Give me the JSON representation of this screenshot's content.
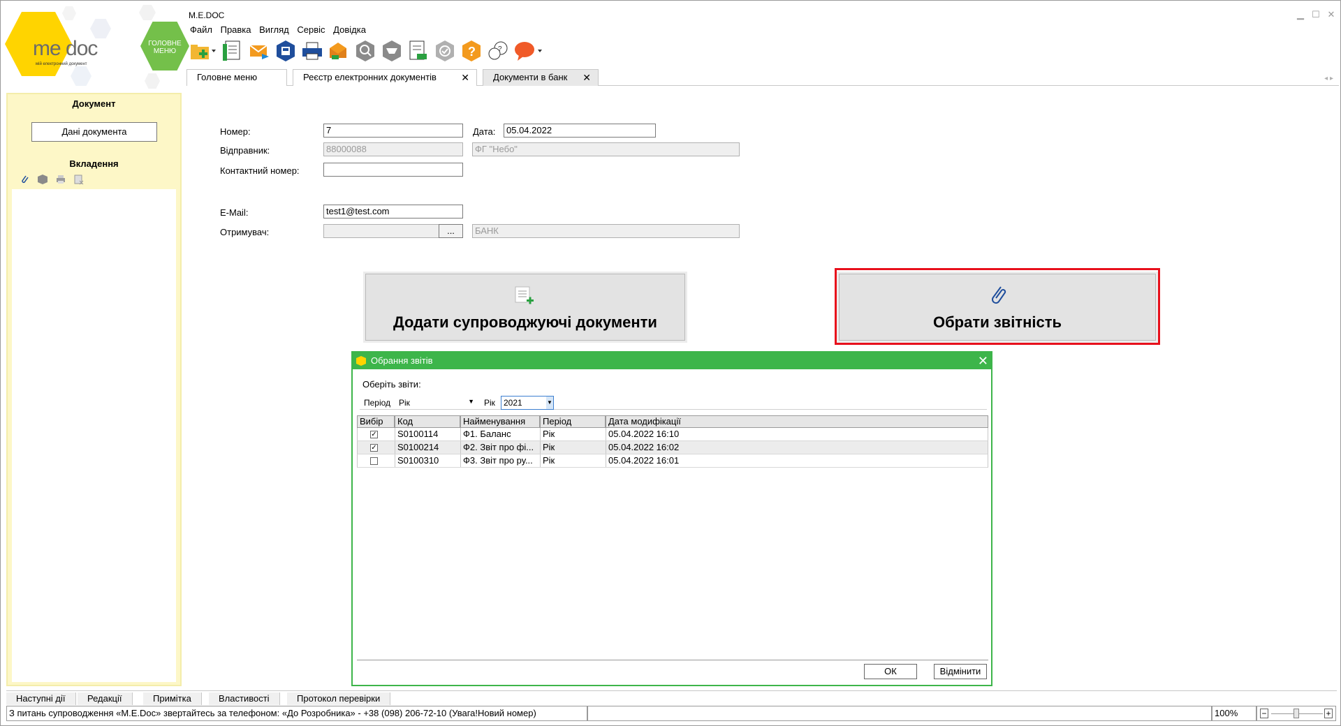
{
  "app": {
    "title": "M.E.DOC",
    "logo_text": "me doc",
    "logo_sub": "мій електронний документ",
    "home_button": "ГОЛОВНЕ МЕНЮ"
  },
  "menu": [
    "Файл",
    "Правка",
    "Вигляд",
    "Сервіс",
    "Довідка"
  ],
  "tabs": [
    {
      "label": "Головне меню",
      "closable": false
    },
    {
      "label": "Реєстр електронних документів",
      "closable": true
    },
    {
      "label": "Документи в банк",
      "closable": true
    }
  ],
  "left_panel": {
    "document_header": "Документ",
    "doc_data_button": "Дані документа",
    "attachments_header": "Вкладення"
  },
  "form": {
    "number_label": "Номер:",
    "number_value": "7",
    "date_label": "Дата:",
    "date_value": "05.04.2022",
    "sender_label": "Відправник:",
    "sender_code": "88000088",
    "sender_name": "ФГ \"Небо\"",
    "contact_label": "Контактний номер:",
    "contact_value": "",
    "email_label": "E-Mail:",
    "email_value": "test1@test.com",
    "recipient_label": "Отримувач:",
    "recipient_code": "",
    "recipient_browse": "...",
    "recipient_name": "БАНК"
  },
  "actions": {
    "add_docs": "Додати супроводжуючі документи",
    "choose_reports": "Обрати звітність"
  },
  "dialog": {
    "title": "Обрання звітів",
    "prompt": "Оберіть звіти:",
    "period_label": "Період",
    "period_value": "Рік",
    "year_label": "Рік",
    "year_value": "2021",
    "columns": [
      "Вибір",
      "Код",
      "Найменування",
      "Період",
      "Дата модифікації"
    ],
    "rows": [
      {
        "checked": true,
        "code": "S0100114",
        "name": "Ф1. Баланс",
        "period": "Рік",
        "modified": "05.04.2022 16:10"
      },
      {
        "checked": true,
        "code": "S0100214",
        "name": "Ф2. Звіт про фі...",
        "period": "Рік",
        "modified": "05.04.2022 16:02"
      },
      {
        "checked": false,
        "code": "S0100310",
        "name": "Ф3. Звіт про ру...",
        "period": "Рік",
        "modified": "05.04.2022 16:01"
      }
    ],
    "ok": "ОК",
    "cancel": "Відмінити"
  },
  "bottom_tabs": [
    "Наступні дії",
    "Редакції",
    "Примітка",
    "Властивості",
    "Протокол перевірки"
  ],
  "status": {
    "message": "З питань супроводження «M.E.Doc» звертайтесь за телефоном: «До Розробника» - +38 (098) 206-72-10 (Увага!Новий номер)",
    "zoom": "100%",
    "zoom_minus": "−",
    "zoom_plus": "+"
  },
  "colors": {
    "accent_green": "#3db54a",
    "highlight_red": "#e8101c",
    "panel_yellow": "#fdf7c7",
    "logo_yellow": "#ffd400"
  }
}
